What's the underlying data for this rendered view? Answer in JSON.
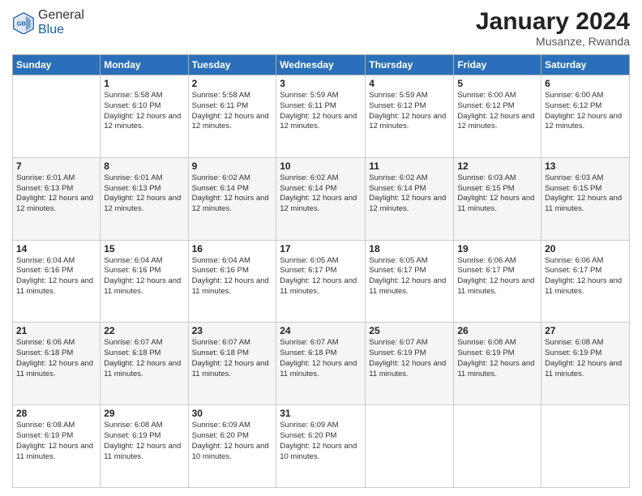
{
  "logo": {
    "general": "General",
    "blue": "Blue"
  },
  "title": {
    "month": "January 2024",
    "location": "Musanze, Rwanda"
  },
  "days_of_week": [
    "Sunday",
    "Monday",
    "Tuesday",
    "Wednesday",
    "Thursday",
    "Friday",
    "Saturday"
  ],
  "weeks": [
    [
      {
        "day": "",
        "sunrise": "",
        "sunset": "",
        "daylight": ""
      },
      {
        "day": "1",
        "sunrise": "Sunrise: 5:58 AM",
        "sunset": "Sunset: 6:10 PM",
        "daylight": "Daylight: 12 hours and 12 minutes."
      },
      {
        "day": "2",
        "sunrise": "Sunrise: 5:58 AM",
        "sunset": "Sunset: 6:11 PM",
        "daylight": "Daylight: 12 hours and 12 minutes."
      },
      {
        "day": "3",
        "sunrise": "Sunrise: 5:59 AM",
        "sunset": "Sunset: 6:11 PM",
        "daylight": "Daylight: 12 hours and 12 minutes."
      },
      {
        "day": "4",
        "sunrise": "Sunrise: 5:59 AM",
        "sunset": "Sunset: 6:12 PM",
        "daylight": "Daylight: 12 hours and 12 minutes."
      },
      {
        "day": "5",
        "sunrise": "Sunrise: 6:00 AM",
        "sunset": "Sunset: 6:12 PM",
        "daylight": "Daylight: 12 hours and 12 minutes."
      },
      {
        "day": "6",
        "sunrise": "Sunrise: 6:00 AM",
        "sunset": "Sunset: 6:12 PM",
        "daylight": "Daylight: 12 hours and 12 minutes."
      }
    ],
    [
      {
        "day": "7",
        "sunrise": "Sunrise: 6:01 AM",
        "sunset": "Sunset: 6:13 PM",
        "daylight": "Daylight: 12 hours and 12 minutes."
      },
      {
        "day": "8",
        "sunrise": "Sunrise: 6:01 AM",
        "sunset": "Sunset: 6:13 PM",
        "daylight": "Daylight: 12 hours and 12 minutes."
      },
      {
        "day": "9",
        "sunrise": "Sunrise: 6:02 AM",
        "sunset": "Sunset: 6:14 PM",
        "daylight": "Daylight: 12 hours and 12 minutes."
      },
      {
        "day": "10",
        "sunrise": "Sunrise: 6:02 AM",
        "sunset": "Sunset: 6:14 PM",
        "daylight": "Daylight: 12 hours and 12 minutes."
      },
      {
        "day": "11",
        "sunrise": "Sunrise: 6:02 AM",
        "sunset": "Sunset: 6:14 PM",
        "daylight": "Daylight: 12 hours and 12 minutes."
      },
      {
        "day": "12",
        "sunrise": "Sunrise: 6:03 AM",
        "sunset": "Sunset: 6:15 PM",
        "daylight": "Daylight: 12 hours and 11 minutes."
      },
      {
        "day": "13",
        "sunrise": "Sunrise: 6:03 AM",
        "sunset": "Sunset: 6:15 PM",
        "daylight": "Daylight: 12 hours and 11 minutes."
      }
    ],
    [
      {
        "day": "14",
        "sunrise": "Sunrise: 6:04 AM",
        "sunset": "Sunset: 6:16 PM",
        "daylight": "Daylight: 12 hours and 11 minutes."
      },
      {
        "day": "15",
        "sunrise": "Sunrise: 6:04 AM",
        "sunset": "Sunset: 6:16 PM",
        "daylight": "Daylight: 12 hours and 11 minutes."
      },
      {
        "day": "16",
        "sunrise": "Sunrise: 6:04 AM",
        "sunset": "Sunset: 6:16 PM",
        "daylight": "Daylight: 12 hours and 11 minutes."
      },
      {
        "day": "17",
        "sunrise": "Sunrise: 6:05 AM",
        "sunset": "Sunset: 6:17 PM",
        "daylight": "Daylight: 12 hours and 11 minutes."
      },
      {
        "day": "18",
        "sunrise": "Sunrise: 6:05 AM",
        "sunset": "Sunset: 6:17 PM",
        "daylight": "Daylight: 12 hours and 11 minutes."
      },
      {
        "day": "19",
        "sunrise": "Sunrise: 6:06 AM",
        "sunset": "Sunset: 6:17 PM",
        "daylight": "Daylight: 12 hours and 11 minutes."
      },
      {
        "day": "20",
        "sunrise": "Sunrise: 6:06 AM",
        "sunset": "Sunset: 6:17 PM",
        "daylight": "Daylight: 12 hours and 11 minutes."
      }
    ],
    [
      {
        "day": "21",
        "sunrise": "Sunrise: 6:06 AM",
        "sunset": "Sunset: 6:18 PM",
        "daylight": "Daylight: 12 hours and 11 minutes."
      },
      {
        "day": "22",
        "sunrise": "Sunrise: 6:07 AM",
        "sunset": "Sunset: 6:18 PM",
        "daylight": "Daylight: 12 hours and 11 minutes."
      },
      {
        "day": "23",
        "sunrise": "Sunrise: 6:07 AM",
        "sunset": "Sunset: 6:18 PM",
        "daylight": "Daylight: 12 hours and 11 minutes."
      },
      {
        "day": "24",
        "sunrise": "Sunrise: 6:07 AM",
        "sunset": "Sunset: 6:18 PM",
        "daylight": "Daylight: 12 hours and 11 minutes."
      },
      {
        "day": "25",
        "sunrise": "Sunrise: 6:07 AM",
        "sunset": "Sunset: 6:19 PM",
        "daylight": "Daylight: 12 hours and 11 minutes."
      },
      {
        "day": "26",
        "sunrise": "Sunrise: 6:08 AM",
        "sunset": "Sunset: 6:19 PM",
        "daylight": "Daylight: 12 hours and 11 minutes."
      },
      {
        "day": "27",
        "sunrise": "Sunrise: 6:08 AM",
        "sunset": "Sunset: 6:19 PM",
        "daylight": "Daylight: 12 hours and 11 minutes."
      }
    ],
    [
      {
        "day": "28",
        "sunrise": "Sunrise: 6:08 AM",
        "sunset": "Sunset: 6:19 PM",
        "daylight": "Daylight: 12 hours and 11 minutes."
      },
      {
        "day": "29",
        "sunrise": "Sunrise: 6:08 AM",
        "sunset": "Sunset: 6:19 PM",
        "daylight": "Daylight: 12 hours and 11 minutes."
      },
      {
        "day": "30",
        "sunrise": "Sunrise: 6:09 AM",
        "sunset": "Sunset: 6:20 PM",
        "daylight": "Daylight: 12 hours and 10 minutes."
      },
      {
        "day": "31",
        "sunrise": "Sunrise: 6:09 AM",
        "sunset": "Sunset: 6:20 PM",
        "daylight": "Daylight: 12 hours and 10 minutes."
      },
      {
        "day": "",
        "sunrise": "",
        "sunset": "",
        "daylight": ""
      },
      {
        "day": "",
        "sunrise": "",
        "sunset": "",
        "daylight": ""
      },
      {
        "day": "",
        "sunrise": "",
        "sunset": "",
        "daylight": ""
      }
    ]
  ]
}
